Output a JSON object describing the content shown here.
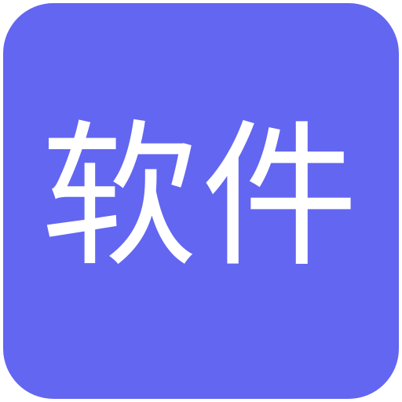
{
  "icon": {
    "label": "软件",
    "background_color": "#6366f1",
    "text_color": "#ffffff"
  }
}
